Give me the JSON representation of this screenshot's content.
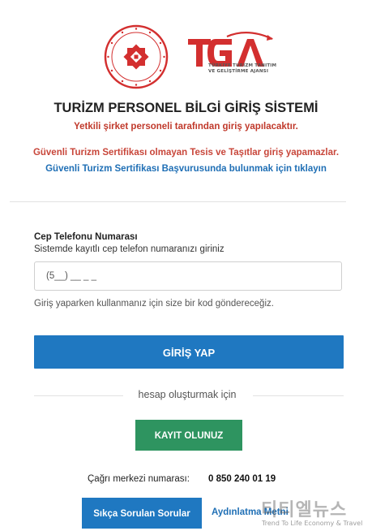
{
  "logos": {
    "ministry_seal_text": "KÜLTÜR VE TURİZM BAKANLIĞI · TÜRKİYE CUMHURİYETİ",
    "tga_mark": "TGA",
    "tga_subtitle": "TÜRKİYE TURİZM TANITIM VE GELİŞTİRME AJANSI",
    "brand_red": "#d32f2f"
  },
  "header": {
    "title": "TURİZM PERSONEL BİLGİ GİRİŞ SİSTEMİ",
    "subtitle": "Yetkili şirket personeli tarafından giriş yapılacaktır.",
    "warning": "Güvenli Turizm Sertifikası olmayan Tesis ve Taşıtlar giriş yapamazlar.",
    "apply_link": "Güvenli Turizm Sertifikası Başvurusunda bulunmak için tıklayın"
  },
  "form": {
    "phone_label": "Cep Telefonu Numarası",
    "phone_help": "Sistemde kayıtlı cep telefon numaranızı giriniz",
    "phone_placeholder": "(5__) __ _ _",
    "phone_value": "",
    "code_note": "Giriş yaparken kullanmanız için size bir kod göndereceğiz.",
    "login_label": "GİRİŞ YAP",
    "login_color": "#1f78c1"
  },
  "register": {
    "separator_text": "hesap oluşturmak için",
    "button_label": "KAYIT OLUNUZ",
    "button_color": "#2e9460"
  },
  "footer": {
    "call_center_label": "Çağrı merkezi numarası:",
    "call_center_number": "0 850 240 01 19",
    "faq_label": "Sıkça Sorulan Sorular",
    "privacy_label": "Aydınlatma Metni"
  },
  "watermark": {
    "korean": "티티엘뉴스",
    "english": "Trend To Life Economy & Travel"
  }
}
